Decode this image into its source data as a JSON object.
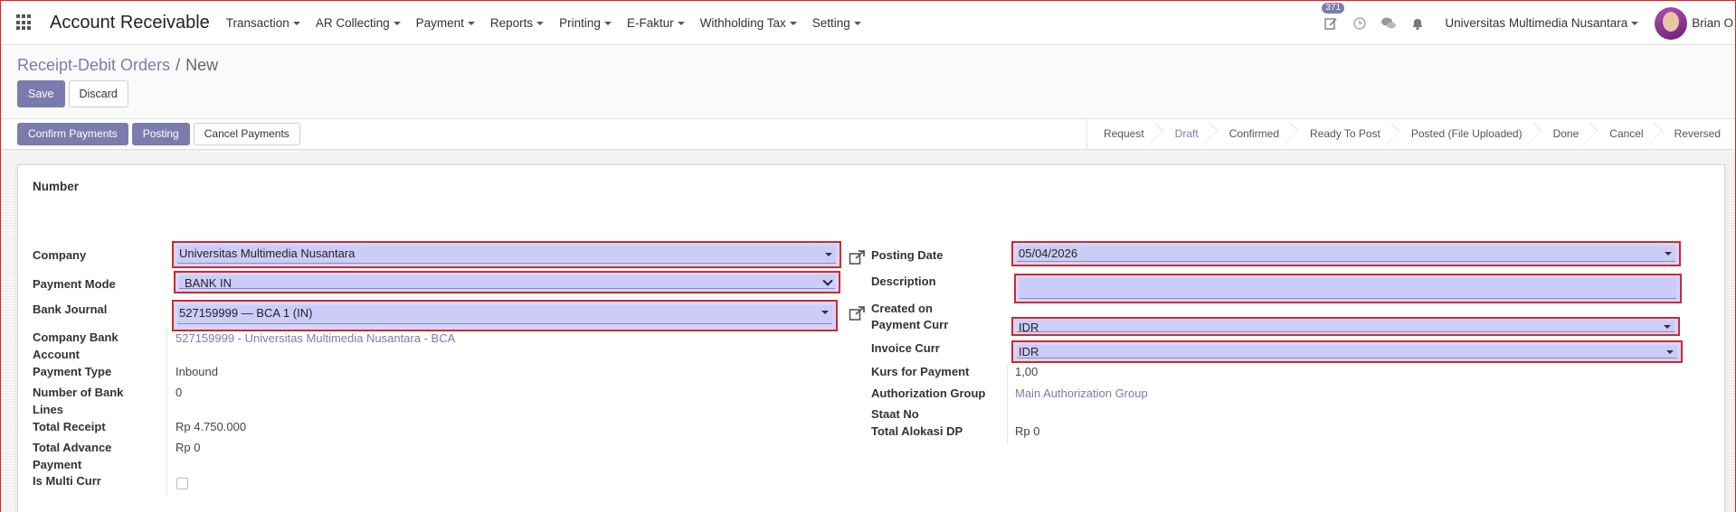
{
  "navbar": {
    "app_title": "Account Receivable",
    "menu": [
      "Transaction",
      "AR Collecting",
      "Payment",
      "Reports",
      "Printing",
      "E-Faktur",
      "Withholding Tax",
      "Setting"
    ],
    "activity_count": "371",
    "company": "Universitas Multimedia Nusantara",
    "user": "Brian O"
  },
  "breadcrumb": {
    "parent": "Receipt-Debit Orders",
    "separator": "/",
    "current": "New"
  },
  "control": {
    "save": "Save",
    "discard": "Discard"
  },
  "statusbar": {
    "buttons": [
      "Confirm Payments",
      "Posting",
      "Cancel Payments"
    ],
    "stages": [
      "Request",
      "Draft",
      "Confirmed",
      "Ready To Post",
      "Posted (File Uploaded)",
      "Done",
      "Cancel",
      "Reversed"
    ],
    "active_stage": "Draft"
  },
  "form": {
    "number_label": "Number",
    "left": {
      "company_label": "Company",
      "company_value": "Universitas Multimedia Nusantara",
      "payment_mode_label": "Payment Mode",
      "payment_mode_value": "BANK IN",
      "bank_journal_label": "Bank Journal",
      "bank_journal_value": "527159999 — BCA 1 (IN)",
      "company_bank_label_1": "Company Bank",
      "company_bank_label_2": "Account",
      "company_bank_value": "527159999 - Universitas Multimedia Nusantara - BCA",
      "payment_type_label": "Payment Type",
      "payment_type_value": "Inbound",
      "bank_lines_label_1": "Number of Bank",
      "bank_lines_label_2": "Lines",
      "bank_lines_value": "0",
      "total_receipt_label": "Total Receipt",
      "total_receipt_value": "Rp 4.750.000",
      "total_advance_label_1": "Total Advance",
      "total_advance_label_2": "Payment",
      "total_advance_value": "Rp 0",
      "multi_curr_label": "Is Multi Curr",
      "multi_curr_checked": false
    },
    "right": {
      "posting_date_label": "Posting Date",
      "posting_date_value": "05/04/2026",
      "description_label": "Description",
      "description_value": "",
      "created_on_label": "Created on",
      "payment_curr_label": "Payment Curr",
      "payment_curr_value": "IDR",
      "invoice_curr_label": "Invoice Curr",
      "invoice_curr_value": "IDR",
      "kurs_label": "Kurs for Payment",
      "kurs_value": "1,00",
      "auth_group_label": "Authorization Group",
      "auth_group_value": "Main Authorization Group",
      "staat_label": "Staat No",
      "total_dp_label": "Total Alokasi DP",
      "total_dp_value": "Rp 0"
    }
  },
  "colors": {
    "primary": "#7c7bad",
    "highlight_border": "#cc2b2b",
    "field_fill": "#ccccf9"
  },
  "icons": [
    "apps-icon",
    "edit-activity-icon",
    "clock-icon",
    "chat-icon",
    "bell-icon",
    "external-link-icon"
  ]
}
